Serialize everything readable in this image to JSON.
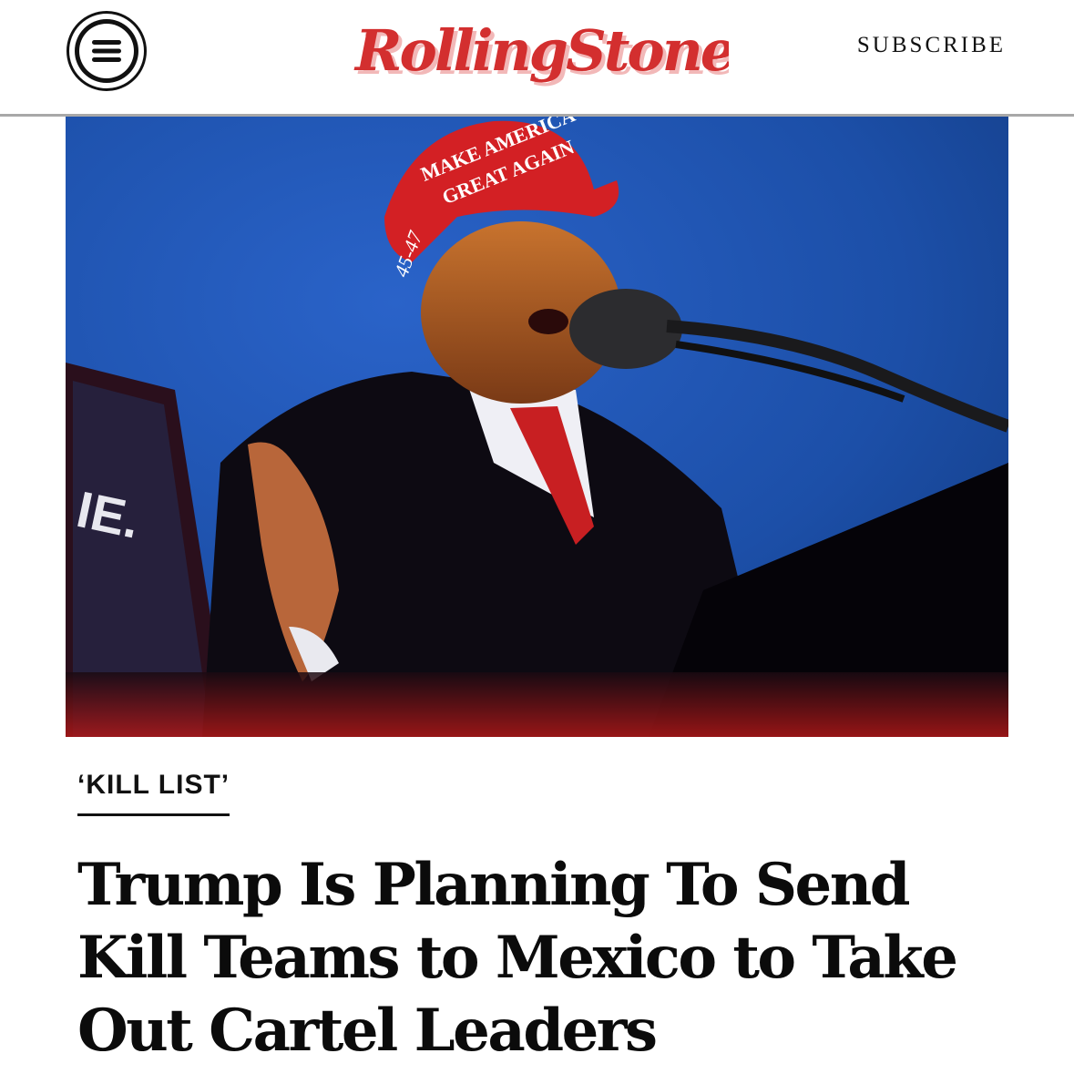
{
  "header": {
    "menu_icon": "hamburger-menu-icon",
    "logo_text": "RollingStone",
    "subscribe_label": "SUBSCRIBE"
  },
  "hero": {
    "cap_text_line1": "MAKE AMERICA",
    "cap_text_line2": "GREAT AGAIN",
    "cap_side_text": "45-47"
  },
  "article": {
    "kicker": "‘KILL LIST’",
    "headline": "Trump Is Planning To Send Kill Teams to Mexico to Take Out Cartel Leaders"
  },
  "colors": {
    "brand_red": "#d32f2f",
    "sky_blue": "#1f56b5",
    "text_dark": "#0b0b0b"
  }
}
